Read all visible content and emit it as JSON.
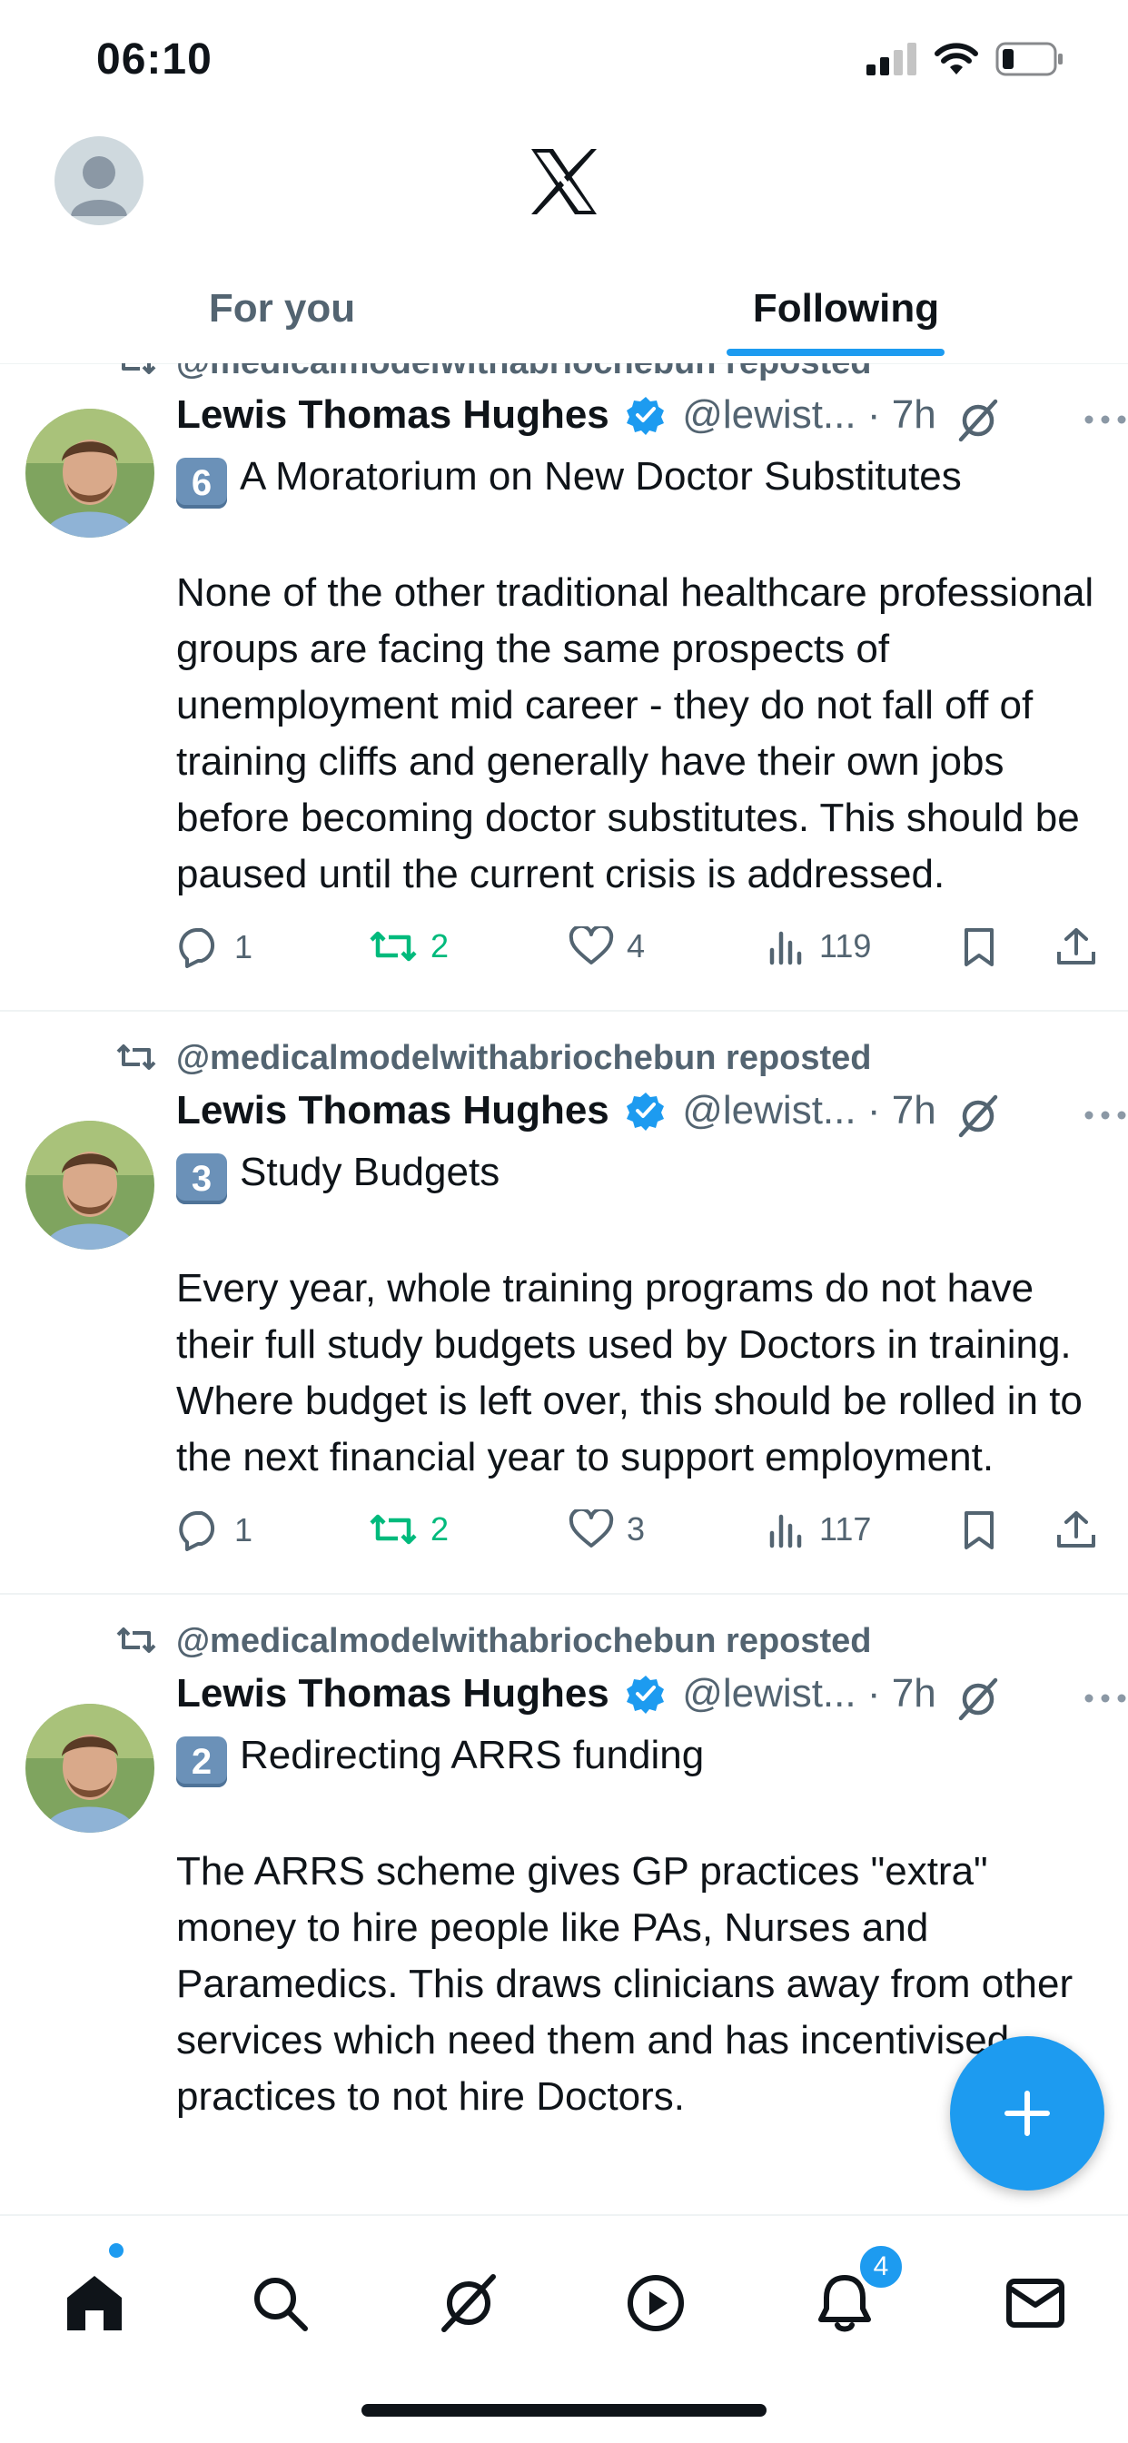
{
  "status_bar": {
    "time": "06:10"
  },
  "header": {
    "tabs": [
      {
        "label": "For you",
        "active": false
      },
      {
        "label": "Following",
        "active": true
      }
    ]
  },
  "tweets": [
    {
      "reposted_by": "@medicalmodelwithabriochebun reposted",
      "author_name": "Lewis Thomas Hughes",
      "verified": true,
      "handle": "@lewist...",
      "separator": " · ",
      "time": "7h",
      "number_emoji": "6",
      "title": "A Moratorium on New Doctor Substitutes",
      "body": "None of the other traditional healthcare professional groups are facing the same prospects of unemployment mid career - they do not fall off of training cliffs and generally have their own jobs before becoming doctor substitutes. This should be paused until the current crisis is addressed.",
      "replies": "1",
      "reposts": "2",
      "likes": "4",
      "views": "119"
    },
    {
      "reposted_by": "@medicalmodelwithabriochebun reposted",
      "author_name": "Lewis Thomas Hughes",
      "verified": true,
      "handle": "@lewist...",
      "separator": " · ",
      "time": "7h",
      "number_emoji": "3",
      "title": "Study Budgets",
      "body": "Every year, whole training programs do not have their full study budgets used by Doctors in training. Where budget is left over, this should be rolled in to the next financial year to support employment.",
      "replies": "1",
      "reposts": "2",
      "likes": "3",
      "views": "117"
    },
    {
      "reposted_by": "@medicalmodelwithabriochebun reposted",
      "author_name": "Lewis Thomas Hughes",
      "verified": true,
      "handle": "@lewist...",
      "separator": " · ",
      "time": "7h",
      "number_emoji": "2",
      "title": "Redirecting ARRS funding",
      "body": "The ARRS scheme gives GP practices \"extra\" money to hire people like PAs, Nurses and Paramedics. This draws clinicians away from other services which need them and has incentivised practices to not hire Doctors.",
      "replies": "",
      "reposts": "",
      "likes": "",
      "views": ""
    }
  ],
  "bottom_nav": {
    "items": [
      "home-icon",
      "search-icon",
      "grok-icon",
      "video-icon",
      "notifications-icon",
      "messages-icon"
    ],
    "notification_count": "4"
  },
  "colors": {
    "accent": "#1d9bf0",
    "repost_green": "#00ba7c",
    "secondary_text": "#536471"
  }
}
